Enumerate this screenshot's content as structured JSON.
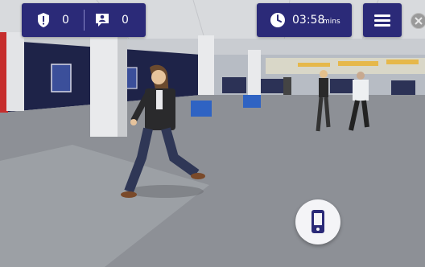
{
  "hud": {
    "badges_count": "0",
    "messages_count": "0",
    "timer_value": "03:58",
    "timer_unit": "mins"
  },
  "icons": {
    "badge": "shield-exclamation-icon",
    "messages": "person-speech-bubble-icon",
    "timer": "clock-icon",
    "menu": "hamburger-menu-icon",
    "close": "close-icon",
    "phone": "mobile-phone-icon"
  },
  "colors": {
    "hud_background": "#2b2a78",
    "hud_text": "#ffffff",
    "phone_button_background": "#f4f4f7",
    "phone_icon": "#2b2a78"
  }
}
